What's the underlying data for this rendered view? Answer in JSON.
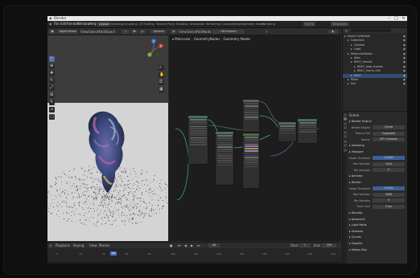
{
  "window": {
    "title": "Blender",
    "controls": [
      "–",
      "□",
      "✕"
    ]
  },
  "menu": [
    "File",
    "Edit",
    "Render",
    "Window",
    "Help"
  ],
  "workspace_tabs": [
    "Layout",
    "Modeling",
    "Sculpting",
    "UV Editing",
    "Texture Paint",
    "Shading",
    "Animation",
    "Rendering",
    "Compositing",
    "Geometry Nodes",
    "Scripting"
  ],
  "active_workspace": "Layout",
  "scene": {
    "name": "Scene",
    "view_layer": "ViewLayer"
  },
  "viewport": {
    "mode": "Object Mode",
    "menus": [
      "View",
      "Select",
      "Add",
      "Object"
    ],
    "options_label": "Options",
    "gizmo_axes": [
      "X",
      "Y",
      "Z"
    ],
    "tools": [
      "select-tool-icon",
      "cursor-tool-icon",
      "move-tool-icon",
      "rotate-tool-icon",
      "scale-tool-icon",
      "transform-tool-icon",
      "annotate-tool-icon",
      "measure-tool-icon",
      "add-cube-tool-icon"
    ]
  },
  "node_editor": {
    "editor_type": "Geometry Node Editor",
    "menus": [
      "View",
      "Select",
      "Add",
      "Node"
    ],
    "node_group": "GN-Proteins",
    "breadcrumb": [
      "Molecular",
      "GeometryNodes",
      "Geometry Nodes"
    ]
  },
  "outliner": {
    "title": "Scene Collection",
    "rows": [
      {
        "label": "Scene Collection",
        "indent": 0,
        "selected": false
      },
      {
        "label": "Collection",
        "indent": 1,
        "selected": false
      },
      {
        "label": "Camera",
        "indent": 2,
        "selected": false
      },
      {
        "label": "Light",
        "indent": 2,
        "selected": false
      },
      {
        "label": "MolecularNodes",
        "indent": 1,
        "selected": false
      },
      {
        "label": "data",
        "indent": 2,
        "selected": false
      },
      {
        "label": "6N2Y_frames",
        "indent": 2,
        "selected": false
      },
      {
        "label": "6N2Y_data_frames",
        "indent": 3,
        "selected": false
      },
      {
        "label": "6N2Y_frame_000",
        "indent": 3,
        "selected": false
      },
      {
        "label": "6N2Y",
        "indent": 2,
        "selected": true
      },
      {
        "label": "Plane",
        "indent": 1,
        "selected": false
      },
      {
        "label": "Sun",
        "indent": 1,
        "selected": false
      }
    ]
  },
  "properties": {
    "breadcrumb": "Scene",
    "rows": [
      {
        "type": "section",
        "label": "Render Engine"
      },
      {
        "type": "field",
        "label": "Render Engine",
        "value": "Cycles",
        "blue": false
      },
      {
        "type": "field",
        "label": "Feature Set",
        "value": "Supported",
        "blue": false
      },
      {
        "type": "field",
        "label": "Device",
        "value": "GPU Compute",
        "blue": false
      },
      {
        "type": "section",
        "label": "Sampling"
      },
      {
        "type": "section",
        "label": "Viewport"
      },
      {
        "type": "field",
        "label": "Noise Threshold",
        "value": "0.1000",
        "blue": true
      },
      {
        "type": "field",
        "label": "Max Samples",
        "value": "1024",
        "blue": false
      },
      {
        "type": "field",
        "label": "Min Samples",
        "value": "0",
        "blue": false
      },
      {
        "type": "section",
        "label": "Denoise"
      },
      {
        "type": "section",
        "label": "Render"
      },
      {
        "type": "field",
        "label": "Noise Threshold",
        "value": "0.0100",
        "blue": true
      },
      {
        "type": "field",
        "label": "Max Samples",
        "value": "4096",
        "blue": false
      },
      {
        "type": "field",
        "label": "Min Samples",
        "value": "0",
        "blue": false
      },
      {
        "type": "field",
        "label": "Time Limit",
        "value": "0 sec",
        "blue": false
      },
      {
        "type": "section",
        "label": "Denoise"
      },
      {
        "type": "section",
        "label": "Advanced"
      },
      {
        "type": "section",
        "label": "Light Paths"
      },
      {
        "type": "section",
        "label": "Volumes"
      },
      {
        "type": "section",
        "label": "Curves"
      },
      {
        "type": "section",
        "label": "Simplify"
      },
      {
        "type": "section",
        "label": "Motion Blur"
      }
    ]
  },
  "timeline": {
    "menus": [
      "Playback",
      "Keying",
      "View",
      "Marker"
    ],
    "current_frame": "48",
    "start_label": "Start",
    "start": "1",
    "end_label": "End",
    "end": "250",
    "frames": [
      "0",
      "20",
      "40",
      "60",
      "80",
      "100",
      "120",
      "140",
      "160",
      "180",
      "200",
      "220",
      "240"
    ]
  }
}
